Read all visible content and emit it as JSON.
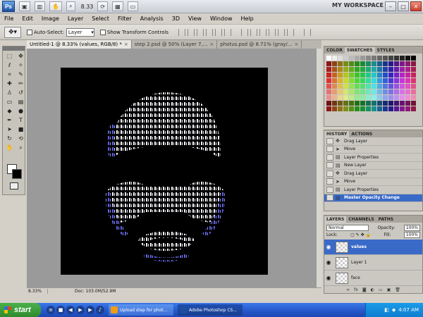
{
  "app": {
    "logo_text": "Ps",
    "zoom_value": "8.33",
    "workspace": "MY WORKSPACE"
  },
  "window_buttons": [
    "–",
    "□",
    "✕"
  ],
  "menu": [
    "File",
    "Edit",
    "Image",
    "Layer",
    "Select",
    "Filter",
    "Analysis",
    "3D",
    "View",
    "Window",
    "Help"
  ],
  "options": {
    "auto_select_label": "Auto-Select:",
    "auto_select_value": "Layer",
    "transform_label": "Show Transform Controls"
  },
  "tabs": [
    {
      "label": "Untitled-1 @ 8.33% (values, RGB/8) *"
    },
    {
      "label": "step 2.psd @ 50% (Layer 7,..."
    },
    {
      "label": "photus.psd @ 8.71% (gray/..."
    }
  ],
  "statusbar": {
    "zoom": "8.33%",
    "doc": "Doc: 103.0M/52.9M"
  },
  "color_panel": {
    "tabs": [
      "COLOR",
      "SWATCHES",
      "STYLES"
    ]
  },
  "history_panel": {
    "tabs": [
      "HISTORY",
      "ACTIONS"
    ],
    "items": [
      "Drag Layer",
      "Move",
      "Layer Properties",
      "New Layer",
      "Drag Layer",
      "Move",
      "Layer Properties",
      "Master Opacity Change"
    ],
    "selected_index": 7
  },
  "layers_panel": {
    "tabs": [
      "LAYERS",
      "CHANNELS",
      "PATHS"
    ],
    "blend_mode": "Normal",
    "opacity_label": "Opacity:",
    "opacity_value": "100%",
    "lock_label": "Lock:",
    "fill_label": "Fill:",
    "fill_value": "100%",
    "layers": [
      {
        "name": "values",
        "selected": true
      },
      {
        "name": "Layer 1",
        "selected": false
      },
      {
        "name": "face",
        "selected": false
      }
    ],
    "footer_icons": [
      "link-icon",
      "fx-icon",
      "mask-icon",
      "adjustment-icon",
      "folder-icon",
      "new-layer-icon",
      "trash-icon"
    ]
  },
  "taskbar": {
    "start_label": "start",
    "tasks": [
      {
        "label": "Upload step for phot...",
        "active": false
      },
      {
        "label": "Adobe Photoshop CS...",
        "active": true
      }
    ],
    "time": "4:07 AM"
  },
  "colors": {
    "canvas": "#000000",
    "selection": "#3a6ac8",
    "glyph_white": "#ffffff",
    "glyph_blue": "#4a4fd8"
  }
}
